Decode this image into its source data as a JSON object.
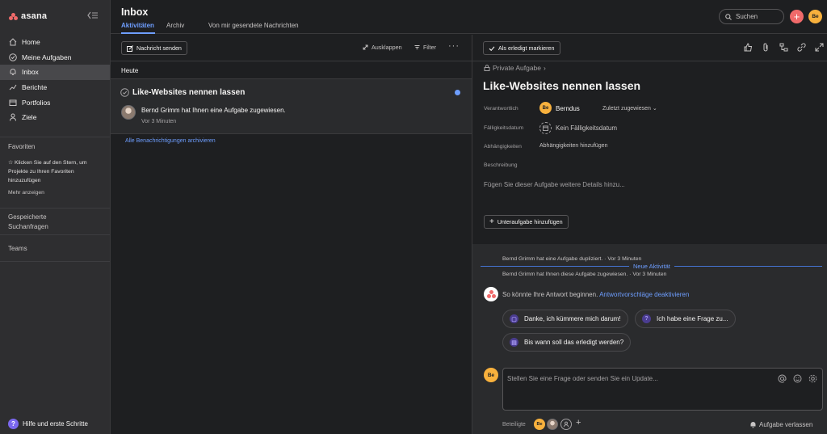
{
  "app": {
    "logo_text": "asana",
    "brand_color": "#f06a6a",
    "accent": "#6e9eff"
  },
  "sidebar": {
    "items": [
      {
        "label": "Home",
        "icon": "home-icon"
      },
      {
        "label": "Meine Aufgaben",
        "icon": "check-circle-icon"
      },
      {
        "label": "Inbox",
        "icon": "bell-icon",
        "active": true
      },
      {
        "label": "Berichte",
        "icon": "chart-icon"
      },
      {
        "label": "Portfolios",
        "icon": "folder-icon"
      },
      {
        "label": "Ziele",
        "icon": "person-icon"
      }
    ],
    "favorites_title": "Favoriten",
    "favorites_hint": "☆ Klicken Sie auf den Stern, um Projekte zu Ihren Favoriten hinzuzufügen",
    "more_link": "Mehr anzeigen",
    "saved_searches": "Gespeicherte Suchanfragen",
    "teams": "Teams",
    "help": "Hilfe und erste Schritte"
  },
  "header": {
    "title": "Inbox",
    "tabs": [
      "Aktivitäten",
      "Archiv",
      "Von mir gesendete Nachrichten"
    ],
    "search_placeholder": "Suchen",
    "avatar_initials": "Be"
  },
  "inbox": {
    "send_message": "Nachricht senden",
    "collapse": "Ausklappen",
    "filter": "Filter",
    "group_label": "Heute",
    "notification": {
      "title": "Like-Websites nennen lassen",
      "text": "Bernd Grimm hat Ihnen eine Aufgabe zugewiesen.",
      "time": "Vor 3 Minuten"
    },
    "archive_all": "Alle Benachrichtigungen archivieren"
  },
  "task": {
    "mark_done": "Als erledigt markieren",
    "privacy": "Private Aufgabe",
    "title": "Like-Websites nennen lassen",
    "fields": {
      "assignee_label": "Verantwortlich",
      "assignee_initials": "Be",
      "assignee_name": "Berndus",
      "assigned_recently": "Zuletzt zugewiesen",
      "due_label": "Fälligkeitsdatum",
      "due_value": "Kein Fälligkeitsdatum",
      "deps_label": "Abhängigkeiten",
      "deps_value": "Abhängigkeiten hinzufügen",
      "desc_label": "Beschreibung"
    },
    "description_placeholder": "Fügen Sie dieser Aufgabe weitere Details hinzu...",
    "add_subtask": "Unteraufgabe hinzufügen"
  },
  "activity": {
    "line1": "Bernd Grimm hat eine Aufgabe dupliziert. · Vor 3 Minuten",
    "new_activity": "Neue Aktivität",
    "line2": "Bernd Grimm hat Ihnen diese Aufgabe zugewiesen. · Vor 3 Minuten",
    "suggest_text": "So könnte Ihre Antwort beginnen.",
    "suggest_disable": "Antwortvorschläge deaktivieren",
    "chips": [
      "Danke, ich kümmere mich darum!",
      "Ich habe eine Frage zu...",
      "Bis wann soll das erledigt werden?"
    ],
    "comment_avatar": "Be",
    "comment_placeholder": "Stellen Sie eine Frage oder senden Sie ein Update...",
    "collaborators_label": "Beteiligte",
    "collaborator_initials": "Be",
    "leave_task": "Aufgabe verlassen"
  }
}
